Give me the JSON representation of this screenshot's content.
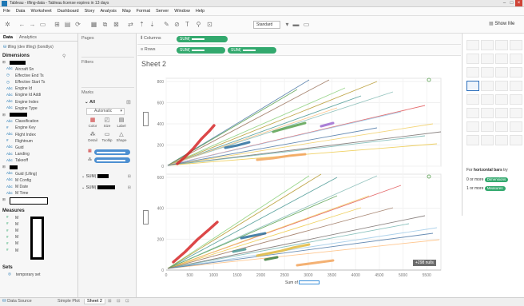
{
  "window": {
    "title": "Tableau - tfling-data - Tableau license expires in 13 days",
    "minimize": "–",
    "maximize": "□",
    "close": "×"
  },
  "menu": [
    "File",
    "Data",
    "Worksheet",
    "Dashboard",
    "Story",
    "Analysis",
    "Map",
    "Format",
    "Server",
    "Window",
    "Help"
  ],
  "toolbar": {
    "fit_select": "Standard",
    "show_me": "Show Me"
  },
  "left_panel": {
    "tabs": [
      "Data",
      "Analytics"
    ],
    "datasource": "tfling (dev tfling) (bondlyx)",
    "dimensions_title": "Dimensions",
    "dimensions": [
      {
        "icon": "folder",
        "label": "",
        "redacted": 20
      },
      {
        "icon": "abc",
        "label": "Aircraft Sn"
      },
      {
        "icon": "cal",
        "label": "Effective End Ts"
      },
      {
        "icon": "cal",
        "label": "Effective Start Ts"
      },
      {
        "icon": "abc",
        "label": "Engine Id"
      },
      {
        "icon": "abc",
        "label": "Engine Id Addi"
      },
      {
        "icon": "abc",
        "label": "Engine Index"
      },
      {
        "icon": "abc",
        "label": "Engine Type"
      },
      {
        "icon": "folder",
        "label": "",
        "redacted": 22
      },
      {
        "icon": "abc",
        "label": "Classification"
      },
      {
        "icon": "#",
        "label": "Engine Key"
      },
      {
        "icon": "abc",
        "label": "Flight Index"
      },
      {
        "icon": "#",
        "label": "Flightnum"
      },
      {
        "icon": "abc",
        "label": "Guid"
      },
      {
        "icon": "abc",
        "label": "Landing"
      },
      {
        "icon": "abc",
        "label": "Takeoff"
      },
      {
        "icon": "folder",
        "label": "",
        "redacted": 10
      },
      {
        "icon": "abc",
        "label": "Guid (Lifing)"
      },
      {
        "icon": "abc",
        "label": "M Config"
      },
      {
        "icon": "abc",
        "label": "M Date"
      },
      {
        "icon": "abc",
        "label": "M Time"
      },
      {
        "icon": "folder",
        "label": "",
        "box": 48
      }
    ],
    "measures_title": "Measures",
    "measures_prefix": [
      "M",
      "M",
      "M",
      "M",
      "M",
      "M"
    ],
    "sets_title": "Sets",
    "sets": [
      "temporary set"
    ]
  },
  "cards": {
    "pages": "Pages",
    "filters": "Filters",
    "marks": "Marks",
    "marks_all": "All",
    "marks_type": "Automatic",
    "mark_buttons": [
      {
        "icon": "color-icon",
        "glyph": "▦",
        "label": "Color"
      },
      {
        "icon": "size-icon",
        "glyph": "◰",
        "label": "Size"
      },
      {
        "icon": "label-icon",
        "glyph": "▤",
        "label": "Label"
      },
      {
        "icon": "detail-icon",
        "glyph": "⁂",
        "label": "Detail"
      },
      {
        "icon": "tooltip-icon",
        "glyph": "▭",
        "label": "Tooltip"
      },
      {
        "icon": "shape-icon",
        "glyph": "△",
        "label": "Shape"
      }
    ],
    "sub_sums": [
      "SUM(",
      "SUM("
    ]
  },
  "shelves": {
    "columns_label": "Columns",
    "rows_label": "Rows",
    "columns_pills": [
      "SUM("
    ],
    "rows_pills": [
      "SUM(",
      "SUM("
    ]
  },
  "sheet": {
    "title": "Sheet 2",
    "y_ticks_top": [
      "800",
      "600",
      "400",
      "200",
      "0"
    ],
    "y_ticks_bottom": [
      "600",
      "400",
      "200",
      "0"
    ],
    "x_ticks": [
      "0",
      "500",
      "1000",
      "1500",
      "2000",
      "2500",
      "3000",
      "3500",
      "4000",
      "4500",
      "5000",
      "5500"
    ],
    "x_label": "Sum of",
    "nulls_badge": "+298 nulls"
  },
  "show_me": {
    "hint_prefix": "For",
    "hint_bold": "horizontal bars",
    "hint_suffix": "try",
    "line1": "0 or more",
    "line1_pill": "Dimensions",
    "line2": "1 or more",
    "line2_pill": "Measures"
  },
  "status": {
    "tabs": [
      "Data Source",
      "Simple Plot",
      "Sheet 2"
    ],
    "active_tab": "Sheet 2"
  },
  "colors": {
    "pill_green": "#33a96e",
    "pill_blue": "#4c8fd1",
    "accent": "#1f77b4"
  }
}
